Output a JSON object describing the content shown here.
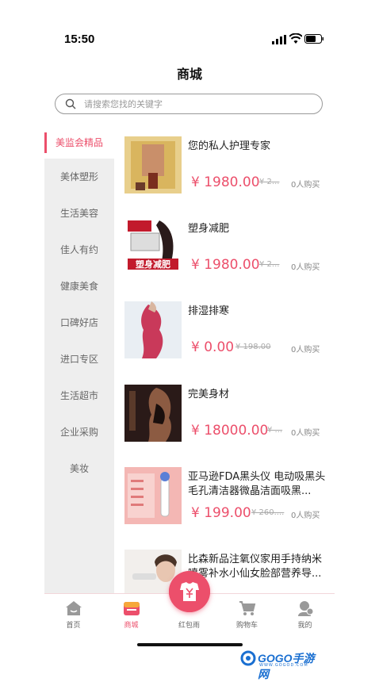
{
  "status": {
    "time": "15:50"
  },
  "header": {
    "title": "商城"
  },
  "search": {
    "placeholder": "请搜索您找的关键字"
  },
  "sidebar": {
    "items": [
      {
        "label": "美监会精品"
      },
      {
        "label": "美体塑形"
      },
      {
        "label": "生活美容"
      },
      {
        "label": "佳人有约"
      },
      {
        "label": "健康美食"
      },
      {
        "label": "口碑好店"
      },
      {
        "label": "进口专区"
      },
      {
        "label": "生活超市"
      },
      {
        "label": "企业采购"
      },
      {
        "label": "美妆"
      }
    ]
  },
  "products": [
    {
      "name": "您的私人护理专家",
      "price": "¥ 1980.00",
      "original_price": "¥ 2...",
      "sold": "0人购买"
    },
    {
      "name": "塑身减肥",
      "price": "¥ 1980.00",
      "original_price": "¥ 2...",
      "sold": "0人购买",
      "thumb_text": "塑身减肥"
    },
    {
      "name": "排湿排寒",
      "price": "¥ 0.00",
      "original_price": "¥ 198.00",
      "sold": "0人购买"
    },
    {
      "name": "完美身材",
      "price": "¥ 18000.00",
      "original_price": "¥ ...",
      "sold": "0人购买"
    },
    {
      "name": "亚马逊FDA黑头仪 电动吸黑头毛孔清洁器微晶洁面吸黑...",
      "price": "¥ 199.00",
      "original_price": "¥ 260....",
      "sold": "0人购买"
    },
    {
      "name": "比森新品注氧仪家用手持纳米喷雾补水小仙女脸部营养导...",
      "price": "",
      "original_price": "",
      "sold": ""
    }
  ],
  "tabbar": {
    "items": [
      {
        "label": "首页"
      },
      {
        "label": "商城"
      },
      {
        "label": "红包雨"
      },
      {
        "label": "购物车"
      },
      {
        "label": "我的"
      }
    ]
  },
  "watermark": {
    "text": "GOGO手游网",
    "sub": "WWW.GOGOD.COM"
  },
  "colors": {
    "accent": "#ec4f6b"
  }
}
